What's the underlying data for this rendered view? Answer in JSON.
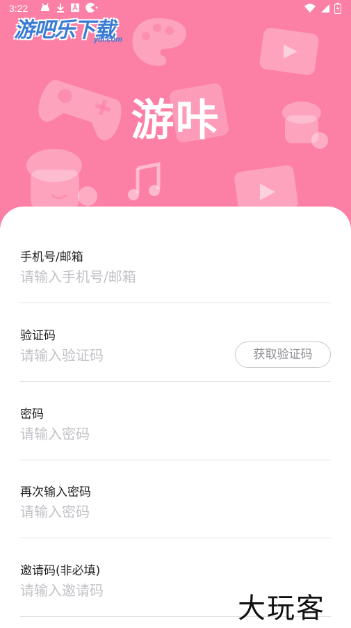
{
  "status_bar": {
    "time": "3:22",
    "icons_left": [
      "android-debug-icon",
      "download-icon",
      "font-icon",
      "pacman-icon"
    ],
    "icons_right": [
      "wifi-icon",
      "signal-icon",
      "battery-icon"
    ]
  },
  "watermark": {
    "logo_text": "游吧乐下载",
    "logo_sub": "y8l.com"
  },
  "header": {
    "app_name": "游咔"
  },
  "form": {
    "phone": {
      "label": "手机号/邮箱",
      "placeholder": "请输入手机号/邮箱"
    },
    "code": {
      "label": "验证码",
      "placeholder": "请输入验证码",
      "button": "获取验证码"
    },
    "password": {
      "label": "密码",
      "placeholder": "请输入密码"
    },
    "password_confirm": {
      "label": "再次输入密码",
      "placeholder": "请输入密码"
    },
    "invite": {
      "label": "邀请码(非必填)",
      "placeholder": "请输入邀请码"
    }
  },
  "corner_watermark": "大玩客",
  "colors": {
    "header_bg": "#fc80a5",
    "placeholder": "#c2c2c8",
    "divider": "#e3e3e3"
  }
}
